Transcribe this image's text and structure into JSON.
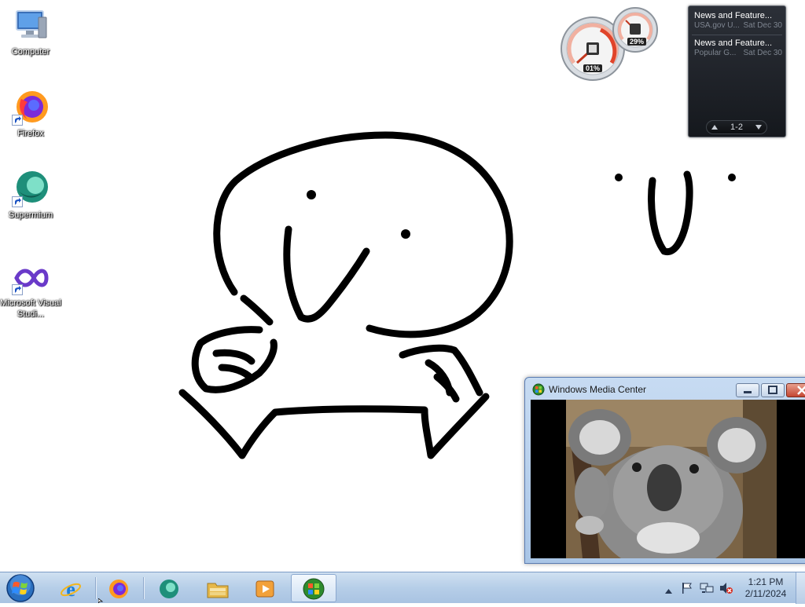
{
  "desktop": {
    "icons": [
      {
        "label": "Computer"
      },
      {
        "label": "Firefox"
      },
      {
        "label": "Supermium"
      },
      {
        "label": "Microsoft Visual Studi..."
      }
    ]
  },
  "gadgets": {
    "cpu_meter": {
      "cpu_percent": "01%",
      "memory_percent": "29%"
    },
    "news_feed": {
      "items": [
        {
          "title": "News and Feature...",
          "source": "USA.gov U...",
          "date": "Sat Dec 30"
        },
        {
          "title": "News and Feature...",
          "source": "Popular G...",
          "date": "Sat Dec 30"
        }
      ],
      "page_label": "1-2"
    }
  },
  "media_center": {
    "title": "Windows Media Center",
    "image_subject": "koala"
  },
  "taskbar": {
    "pinned": [
      {
        "icon": "internet-explorer-icon"
      },
      {
        "icon": "firefox-icon"
      },
      {
        "icon": "supermium-icon"
      },
      {
        "icon": "file-explorer-icon"
      },
      {
        "icon": "media-player-icon"
      },
      {
        "icon": "windows-media-center-icon",
        "active": true
      }
    ],
    "clock": {
      "time": "1:21 PM",
      "date": "2/11/2024"
    }
  },
  "colors": {
    "taskbar_top": "#cfe0f1",
    "taskbar_bottom": "#a9c3e2",
    "gadget_dark": "#1a1d22",
    "close_red": "#c44631"
  }
}
